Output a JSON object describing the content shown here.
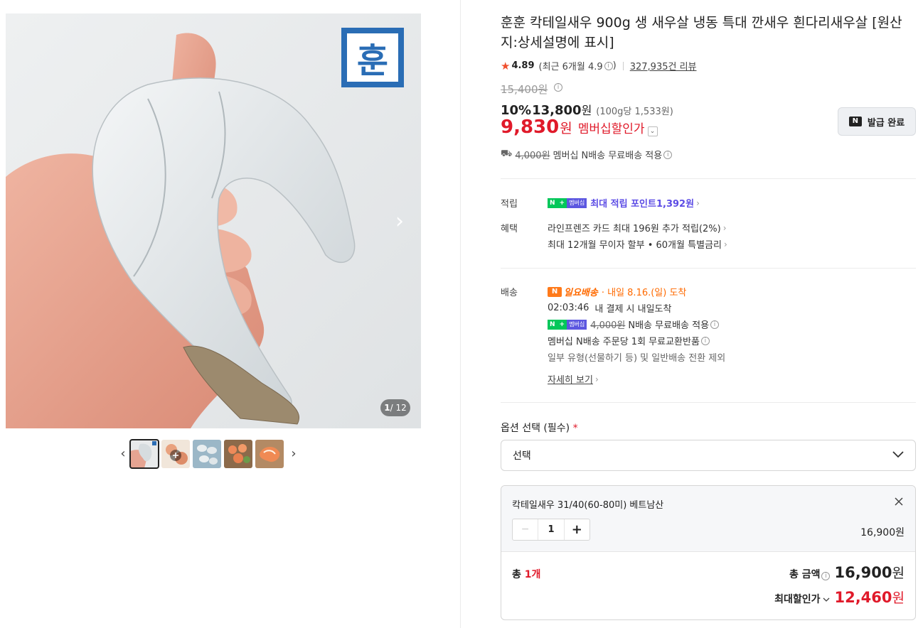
{
  "gallery": {
    "logo_text": "훈",
    "counter_current": "1",
    "counter_total": "/ 12",
    "next_arrow": "›",
    "thumb_prev": "‹",
    "thumb_next": "›"
  },
  "product": {
    "title": "훈훈 칵테일새우 900g 생 새우살 냉동 특대 깐새우 흰다리새우살 [원산지:상세설명에 표시]",
    "rating": "4.89",
    "recent_rating": "(최근 6개월 4.9",
    "recent_rating_close": ")",
    "review_count": "327,935건 리뷰",
    "original_price": "15,400원",
    "discount_rate": "10%",
    "discount_price": "13,800",
    "discount_won": "원",
    "unit_price": "(100g당 1,533원)",
    "member_price": "9,830",
    "member_won": "원",
    "member_label": "멤버십할인가",
    "coupon_label": "발급 완료",
    "shipping_strike": "4,000원",
    "shipping_text": "멤버십 N배송 무료배송 적용"
  },
  "benefits": {
    "points_label": "적립",
    "points_badge_n": "N",
    "points_badge_plus": "멤버십",
    "points_text": "최대 적립 포인트 ",
    "points_value": "1,392원",
    "benefit_label": "혜택",
    "benefit_line1": "라인프렌즈 카드 최대 196원 추가 적립(2%)",
    "benefit_line2": "최대 12개월 무이자 할부 • 60개월 특별금리"
  },
  "delivery": {
    "label": "배송",
    "badge": "N",
    "nextday_brand": "일요배송",
    "nextday_text": "· 내일 8.16.(일) 도착",
    "countdown": "02:03:46",
    "countdown_text": "내 결제 시 내일도착",
    "n_strike": "4,000원",
    "n_text": "N배송 무료배송 적용",
    "exchange_text": "멤버십 N배송 주문당 1회 무료교환반품",
    "exclude_text": "일부 유형(선물하기 등) 및 일반배송 전환 제외",
    "detail_link": "자세히 보기"
  },
  "options": {
    "label": "옵션 선택 (필수)",
    "required_mark": "*",
    "select_placeholder": "선택"
  },
  "cart": {
    "item_name": "칵테일새우 31/40(60-80미) 베트남산",
    "quantity": "1",
    "item_price": "16,900원",
    "total_prefix": "총 ",
    "total_count": "1개",
    "total_label": "총 금액",
    "total_amount": "16,900",
    "total_won": "원",
    "max_label": "최대할인가",
    "max_amount": "12,460",
    "max_won": "원"
  },
  "colors": {
    "accent_red": "#e01a2a",
    "point_purple": "#5c4ce5",
    "naver_green": "#03c75a",
    "nextday_orange": "#ff6a00"
  }
}
